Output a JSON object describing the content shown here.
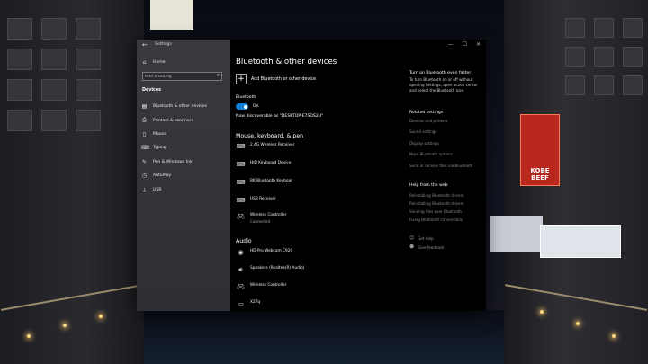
{
  "window": {
    "app_title": "Settings",
    "back_glyph": "←",
    "controls": [
      "—",
      "☐",
      "✕"
    ]
  },
  "sidebar": {
    "home": "Home",
    "search_placeholder": "Find a setting",
    "section": "Devices",
    "items": [
      {
        "label": "Bluetooth & other devices",
        "icon": "bluetooth-icon"
      },
      {
        "label": "Printers & scanners",
        "icon": "printer-icon"
      },
      {
        "label": "Mouse",
        "icon": "mouse-icon"
      },
      {
        "label": "Typing",
        "icon": "keyboard-icon"
      },
      {
        "label": "Pen & Windows Ink",
        "icon": "pen-icon"
      },
      {
        "label": "AutoPlay",
        "icon": "autoplay-icon"
      },
      {
        "label": "USB",
        "icon": "usb-icon"
      }
    ]
  },
  "main": {
    "title": "Bluetooth & other devices",
    "add_label": "Add Bluetooth or other device",
    "bluetooth_label": "Bluetooth",
    "toggle_state": "On",
    "discoverable": "Now discoverable as \"DESKTOP-E7SOS2U\"",
    "group1_title": "Mouse, keyboard, & pen",
    "group1": [
      {
        "name": "2.4G Wireless Receiver",
        "sub": ""
      },
      {
        "name": "HID Keyboard Device",
        "sub": ""
      },
      {
        "name": "BK Bluetooth Keyboar",
        "sub": ""
      },
      {
        "name": "USB Receiver",
        "sub": ""
      },
      {
        "name": "Wireless Controller",
        "sub": "Connected"
      }
    ],
    "group2_title": "Audio",
    "group2": [
      {
        "name": "HD Pro Webcam C920",
        "sub": ""
      },
      {
        "name": "Speakers (Realtek(R) Audio)",
        "sub": ""
      },
      {
        "name": "Wireless Controller",
        "sub": ""
      },
      {
        "name": "X27q",
        "sub": ""
      }
    ]
  },
  "related": {
    "tip_head": "Turn on Bluetooth even faster",
    "tip_text": "To turn Bluetooth on or off without opening Settings, open action center and select the Bluetooth icon.",
    "related_head": "Related settings",
    "related_links": [
      "Devices and printers",
      "Sound settings",
      "Display settings",
      "More Bluetooth options",
      "Send or receive files via Bluetooth"
    ],
    "help_head": "Help from the web",
    "help_links": [
      "Reinstalling Bluetooth drivers",
      "Reinstalling Bluetooth drivers",
      "Sending files over Bluetooth",
      "Fixing Bluetooth connections"
    ],
    "get_help": "Get help",
    "give_feedback": "Give feedback"
  },
  "wallpaper": {
    "sign_text": "KOBE BEEF"
  }
}
